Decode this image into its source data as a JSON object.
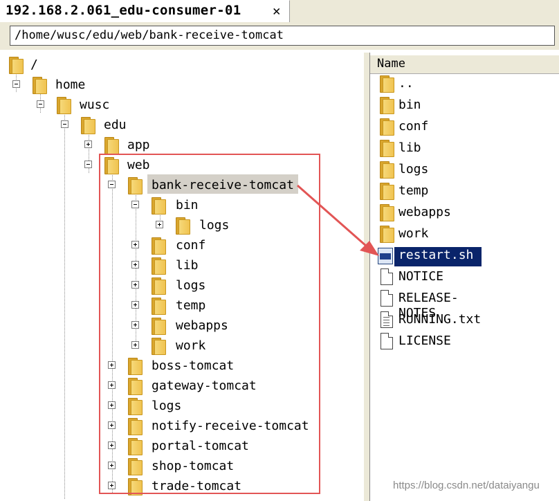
{
  "tab": {
    "title": "192.168.2.061_edu-consumer-01",
    "close_label": "✕"
  },
  "path": {
    "value": "/home/wusc/edu/web/bank-receive-tomcat"
  },
  "tree": {
    "root": "/",
    "home": "home",
    "wusc": "wusc",
    "edu": "edu",
    "app": "app",
    "web": "web",
    "bank": "bank-receive-tomcat",
    "bin": "bin",
    "bin_logs": "logs",
    "conf": "conf",
    "lib": "lib",
    "logs": "logs",
    "temp": "temp",
    "webapps": "webapps",
    "work": "work",
    "boss": "boss-tomcat",
    "gateway": "gateway-tomcat",
    "web_logs": "logs",
    "notify": "notify-receive-tomcat",
    "portal": "portal-tomcat",
    "shop": "shop-tomcat",
    "trade": "trade-tomcat"
  },
  "file_list": {
    "column_name": "Name",
    "items": [
      "..",
      "bin",
      "conf",
      "lib",
      "logs",
      "temp",
      "webapps",
      "work",
      "restart.sh",
      "NOTICE",
      "RELEASE-NOTES",
      "RUNNING.txt",
      "LICENSE"
    ]
  },
  "annotation": {
    "color": "#e25555"
  },
  "watermark": "https://blog.csdn.net/dataiyangu"
}
